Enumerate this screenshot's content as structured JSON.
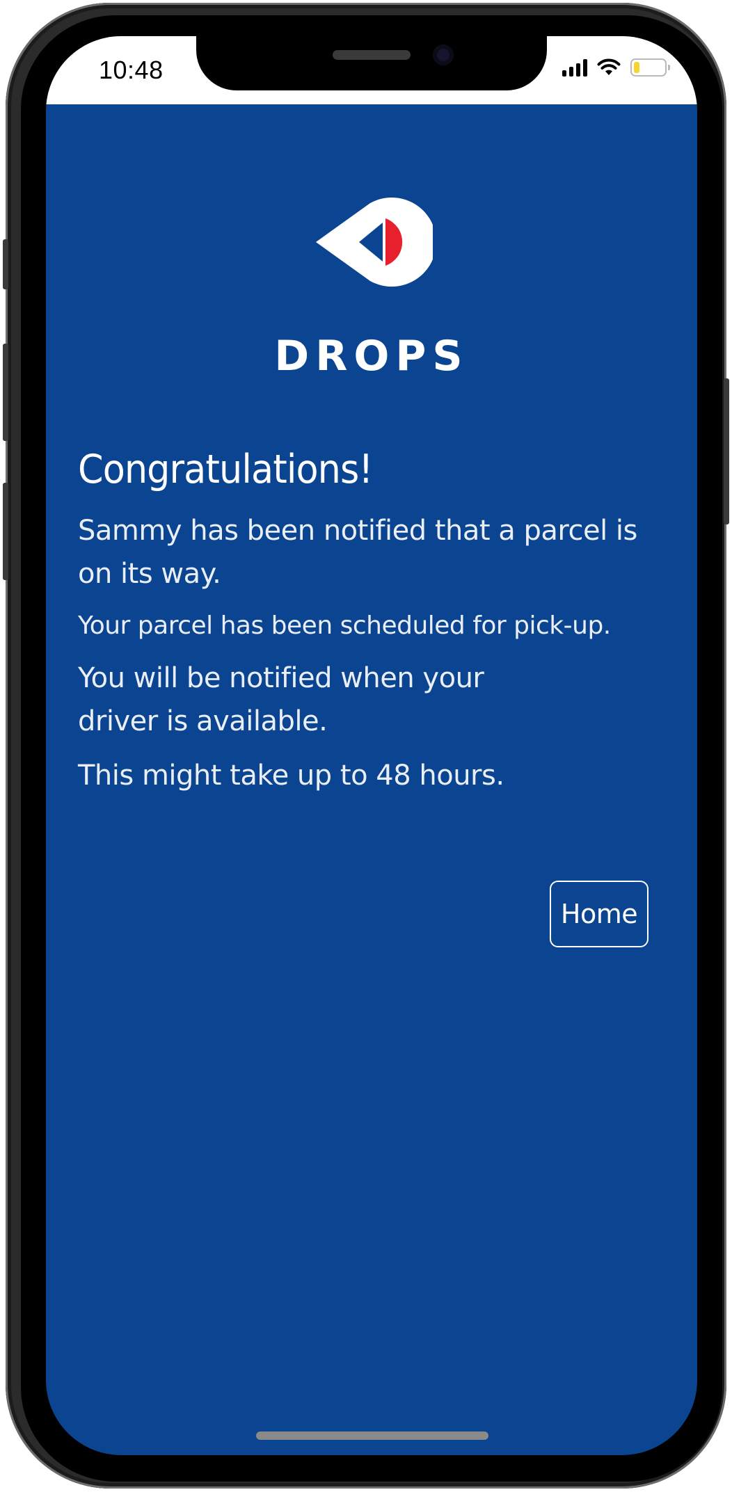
{
  "status_bar": {
    "time": "10:48"
  },
  "brand": {
    "name": "DROPS",
    "colors": {
      "background": "#0b4490",
      "logo_white": "#ffffff",
      "logo_red": "#e8202e",
      "logo_blue": "#0b4490"
    }
  },
  "message": {
    "title": "Congratulations!",
    "notified_text": "Sammy has been notified that a parcel is on its way.",
    "scheduled_text": "Your parcel has been scheduled for pick-up.",
    "driver_text": "You will be notified when your driver is available.",
    "timing_text": "This might take up to 48 hours."
  },
  "actions": {
    "home_label": "Home"
  },
  "icons": {
    "signal": "cellular-signal-icon",
    "wifi": "wifi-icon",
    "battery": "battery-icon",
    "battery_level": 0.2
  }
}
